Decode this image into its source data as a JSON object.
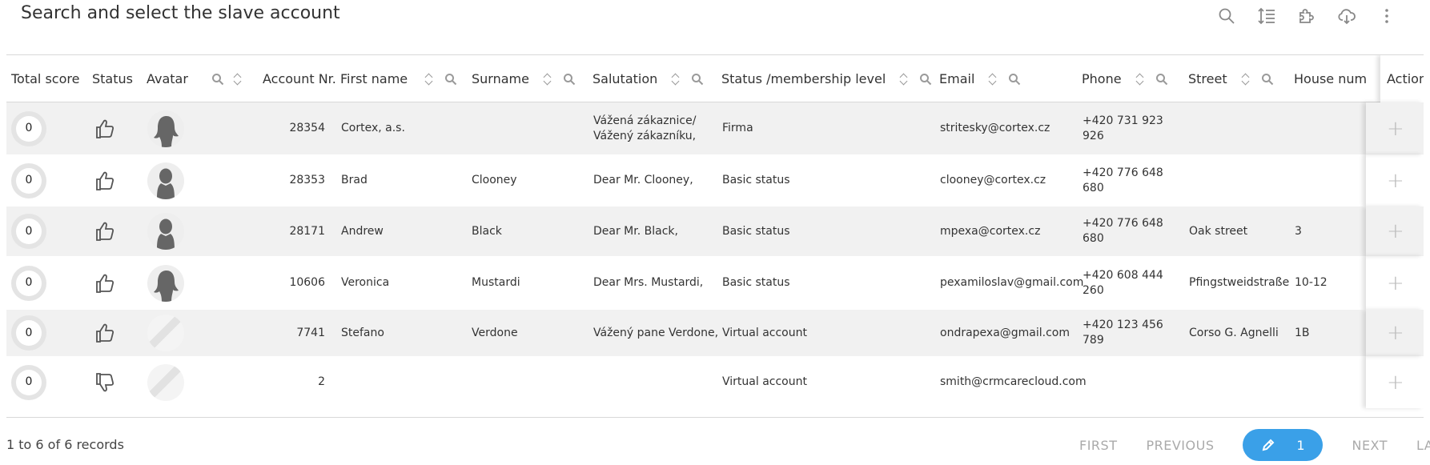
{
  "title": "Search and select the slave account",
  "toolbar": {
    "icons": [
      "search-icon",
      "list-sort-icon",
      "puzzle-icon",
      "cloud-download-icon",
      "more-vertical-icon"
    ]
  },
  "columns": {
    "total_score": "Total score",
    "status": "Status",
    "avatar": "Avatar",
    "account_nr": "Account Nr.",
    "first_name": "First name",
    "surname": "Surname",
    "salutation": "Salutation",
    "membership": "Status /membership level",
    "email": "Email",
    "phone": "Phone",
    "street": "Street",
    "house_number": "House numb",
    "action": "Action"
  },
  "rows": [
    {
      "score": "0",
      "status": "thumbs-up",
      "avatar": "female",
      "account": "28354",
      "first": "Cortex, a.s.",
      "surname": "",
      "salutation": "Vážená zákaznice/ Vážený zákazníku,",
      "membership": "Firma",
      "email": "stritesky@cortex.cz",
      "phone": "+420 731 923 926",
      "street": "",
      "house": ""
    },
    {
      "score": "0",
      "status": "thumbs-up",
      "avatar": "male",
      "account": "28353",
      "first": "Brad",
      "surname": "Clooney",
      "salutation": "Dear Mr. Clooney,",
      "membership": "Basic status",
      "email": "clooney@cortex.cz",
      "phone": "+420 776 648 680",
      "street": "",
      "house": ""
    },
    {
      "score": "0",
      "status": "thumbs-up",
      "avatar": "male",
      "account": "28171",
      "first": "Andrew",
      "surname": "Black",
      "salutation": "Dear Mr. Black,",
      "membership": "Basic status",
      "email": "mpexa@cortex.cz",
      "phone": "+420 776 648 680",
      "street": "Oak street",
      "house": "3"
    },
    {
      "score": "0",
      "status": "thumbs-up",
      "avatar": "female",
      "account": "10606",
      "first": "Veronica",
      "surname": "Mustardi",
      "salutation": "Dear Mrs. Mustardi,",
      "membership": "Basic status",
      "email": "pexamiloslav@gmail.com",
      "phone": "+420 608 444 260",
      "street": "Pfingstweidstraße",
      "house": "10-12"
    },
    {
      "score": "0",
      "status": "thumbs-up",
      "avatar": "none",
      "account": "7741",
      "first": "Stefano",
      "surname": "Verdone",
      "salutation": "Vážený pane Verdone,",
      "membership": "Virtual account",
      "email": "ondrapexa@gmail.com",
      "phone": "+420 123 456 789",
      "street": "Corso G. Agnelli",
      "house": "1B"
    },
    {
      "score": "0",
      "status": "thumbs-down",
      "avatar": "none",
      "account": "2",
      "first": "",
      "surname": "",
      "salutation": "",
      "membership": "Virtual account",
      "email": "smith@crmcarecloud.com",
      "phone": "",
      "street": "",
      "house": ""
    }
  ],
  "footer": {
    "records_text": "1 to 6 of 6 records",
    "first": "FIRST",
    "previous": "PREVIOUS",
    "current_page": "1",
    "next": "NEXT",
    "last": "LAST"
  }
}
